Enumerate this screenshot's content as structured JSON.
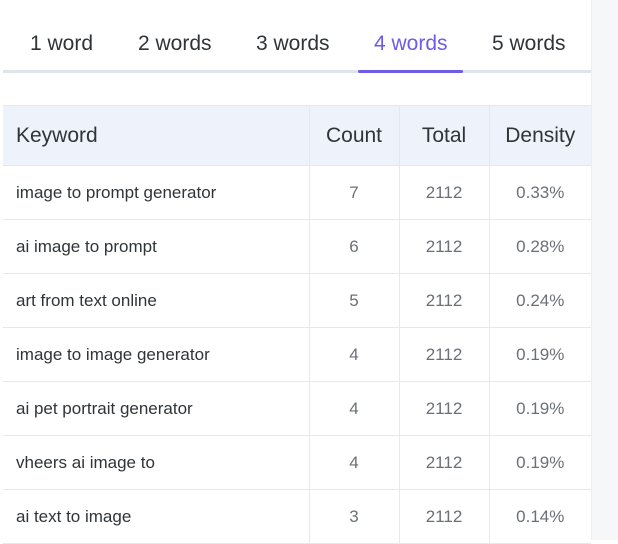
{
  "tabs": [
    {
      "label": "1 word"
    },
    {
      "label": "2 words"
    },
    {
      "label": "3 words"
    },
    {
      "label": "4 words",
      "active": true
    },
    {
      "label": "5 words"
    }
  ],
  "colors": {
    "accent": "#6c5ce7",
    "header_bg": "#eef3fb",
    "border": "#e5e8ee"
  },
  "table": {
    "headers": {
      "keyword": "Keyword",
      "count": "Count",
      "total": "Total",
      "density": "Density"
    },
    "rows": [
      {
        "keyword": "image to prompt generator",
        "count": "7",
        "total": "2112",
        "density": "0.33%"
      },
      {
        "keyword": "ai image to prompt",
        "count": "6",
        "total": "2112",
        "density": "0.28%"
      },
      {
        "keyword": "art from text online",
        "count": "5",
        "total": "2112",
        "density": "0.24%"
      },
      {
        "keyword": "image to image generator",
        "count": "4",
        "total": "2112",
        "density": "0.19%"
      },
      {
        "keyword": "ai pet portrait generator",
        "count": "4",
        "total": "2112",
        "density": "0.19%"
      },
      {
        "keyword": "vheers ai image to",
        "count": "4",
        "total": "2112",
        "density": "0.19%"
      },
      {
        "keyword": "ai text to image",
        "count": "3",
        "total": "2112",
        "density": "0.14%"
      }
    ]
  }
}
